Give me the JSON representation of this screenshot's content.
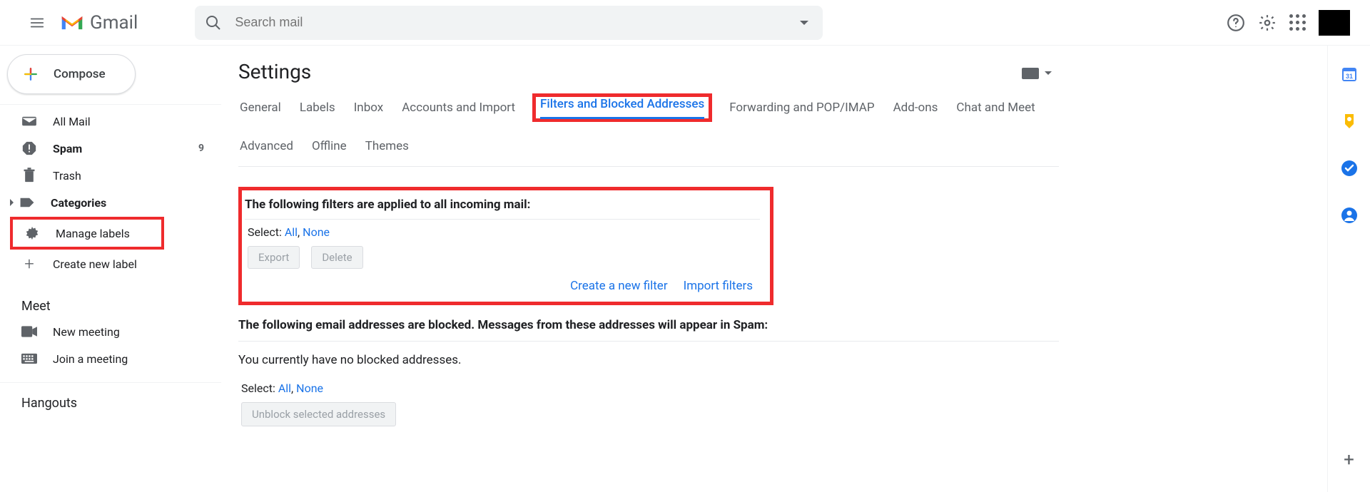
{
  "header": {
    "app_name": "Gmail",
    "search_placeholder": "Search mail"
  },
  "compose": {
    "label": "Compose"
  },
  "sidebar": {
    "items": [
      {
        "label": "All Mail",
        "bold": false
      },
      {
        "label": "Spam",
        "bold": true,
        "count": "9"
      },
      {
        "label": "Trash",
        "bold": false
      },
      {
        "label": "Categories",
        "bold": true
      },
      {
        "label": "Manage labels"
      },
      {
        "label": "Create new label"
      }
    ],
    "meet_header": "Meet",
    "meet": [
      {
        "label": "New meeting"
      },
      {
        "label": "Join a meeting"
      }
    ],
    "hangouts_header": "Hangouts"
  },
  "settings": {
    "title": "Settings",
    "tabs": [
      "General",
      "Labels",
      "Inbox",
      "Accounts and Import",
      "Filters and Blocked Addresses",
      "Forwarding and POP/IMAP",
      "Add-ons",
      "Chat and Meet",
      "Advanced",
      "Offline",
      "Themes"
    ],
    "active_tab": 4
  },
  "filters": {
    "heading": "The following filters are applied to all incoming mail:",
    "select_label": "Select:",
    "select_all": "All",
    "select_none": "None",
    "export": "Export",
    "delete": "Delete",
    "create_link": "Create a new filter",
    "import_link": "Import filters"
  },
  "blocked": {
    "heading": "The following email addresses are blocked. Messages from these addresses will appear in Spam:",
    "empty_text": "You currently have no blocked addresses.",
    "select_label": "Select:",
    "select_all": "All",
    "select_none": "None",
    "unblock": "Unblock selected addresses"
  }
}
